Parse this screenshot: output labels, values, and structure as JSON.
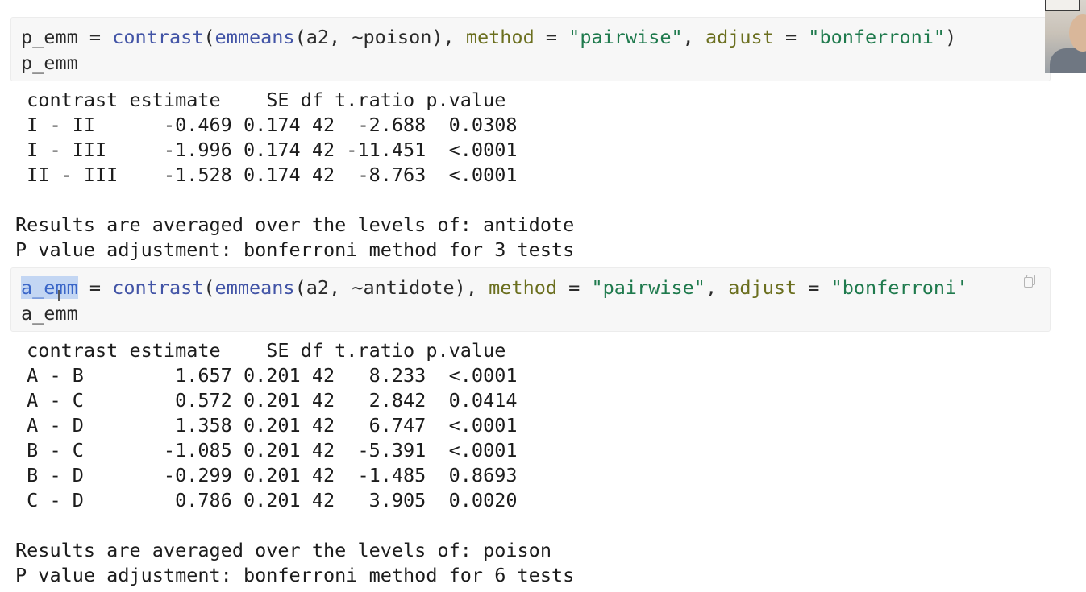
{
  "chunk1": {
    "line1": {
      "var": "p_emm",
      "assign": " = ",
      "fn1": "contrast",
      "p1": "(",
      "fn2": "emmeans",
      "p2": "(a2, ~poison), ",
      "arg1": "method",
      "eq1": " = ",
      "str1": "\"pairwise\"",
      "comma": ", ",
      "arg2": "adjust",
      "eq2": " = ",
      "str2": "\"bonferroni\"",
      "close": ")"
    },
    "line2": "p_emm"
  },
  "output1": {
    "header": " contrast estimate    SE df t.ratio p.value",
    "rows": [
      " I - II      -0.469 0.174 42  -2.688  0.0308",
      " I - III     -1.996 0.174 42 -11.451  <.0001",
      " II - III    -1.528 0.174 42  -8.763  <.0001"
    ],
    "note1": "Results are averaged over the levels of: antidote",
    "note2": "P value adjustment: bonferroni method for 3 tests"
  },
  "chunk2": {
    "line1": {
      "var_sel": "a_emm",
      "assign": " = ",
      "fn1": "contrast",
      "p1": "(",
      "fn2": "emmeans",
      "p2": "(a2, ~antidote), ",
      "arg1": "method",
      "eq1": " = ",
      "str1": "\"pairwise\"",
      "comma": ", ",
      "arg2": "adjust",
      "eq2": " = ",
      "str2": "\"bonferroni'"
    },
    "line2": "a_emm"
  },
  "output2": {
    "header": " contrast estimate    SE df t.ratio p.value",
    "rows": [
      " A - B        1.657 0.201 42   8.233  <.0001",
      " A - C        0.572 0.201 42   2.842  0.0414",
      " A - D        1.358 0.201 42   6.747  <.0001",
      " B - C       -1.085 0.201 42  -5.391  <.0001",
      " B - D       -0.299 0.201 42  -1.485  0.8693",
      " C - D        0.786 0.201 42   3.905  0.0020"
    ],
    "note1": "Results are averaged over the levels of: poison",
    "note2": "P value adjustment: bonferroni method for 6 tests"
  },
  "icons": {
    "copy": "copy-icon",
    "webcam": "webcam-overlay"
  }
}
